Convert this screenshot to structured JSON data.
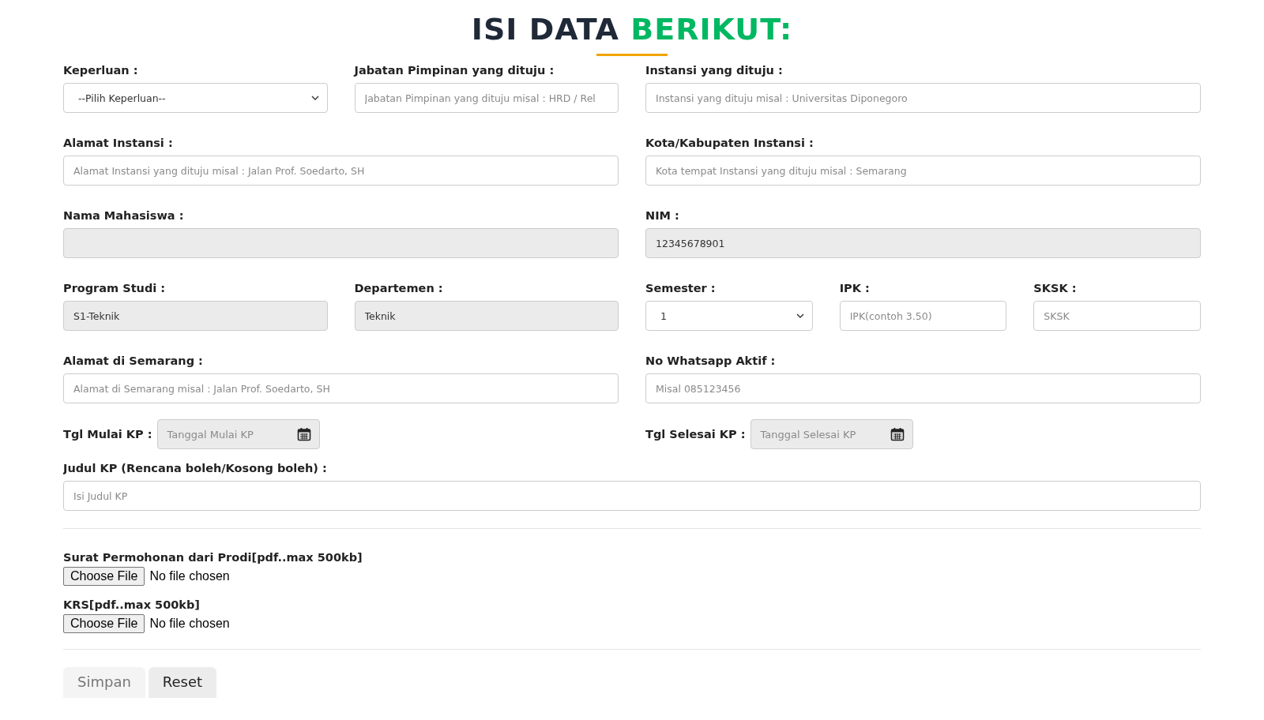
{
  "title": {
    "text": "ISI DATA",
    "highlight": "BERIKUT:"
  },
  "rows": [
    [
      {
        "label": "Keperluan :",
        "kind": "select",
        "value": "--Pilih Keperluan--",
        "readonly": false
      },
      {
        "label": "Jabatan Pimpinan yang dituju :",
        "kind": "text",
        "placeholder": "Jabatan Pimpinan yang dituju misal : HRD / Rel",
        "readonly": false
      },
      {
        "label": "Instansi yang dituju :",
        "kind": "text",
        "placeholder": "Instansi yang dituju misal : Universitas Diponegoro",
        "readonly": false
      }
    ],
    [
      {
        "label": "Alamat Instansi :",
        "kind": "text",
        "placeholder": "Alamat Instansi yang dituju misal : Jalan Prof. Soedarto, SH",
        "readonly": false
      },
      {
        "label": "Kota/Kabupaten Instansi :",
        "kind": "text",
        "placeholder": "Kota tempat Instansi yang dituju misal : Semarang",
        "readonly": false
      }
    ],
    [
      {
        "label": "Nama Mahasiswa :",
        "kind": "text",
        "readonly": true
      },
      {
        "label": "NIM :",
        "kind": "text",
        "value": "12345678901",
        "readonly": true
      }
    ],
    [
      {
        "label": "Program Studi :",
        "kind": "text",
        "value": "S1-Teknik",
        "readonly": true
      },
      {
        "label": "Departemen :",
        "kind": "text",
        "value": "Teknik",
        "readonly": true
      },
      {
        "label": "Semester :",
        "kind": "select",
        "value": "1",
        "readonly": false
      },
      {
        "label": "IPK :",
        "kind": "text",
        "placeholder": "IPK(contoh 3.50)",
        "readonly": false
      },
      {
        "label": "SKSK :",
        "kind": "text",
        "placeholder": "SKSK",
        "readonly": false
      }
    ],
    [
      {
        "label": "Alamat di Semarang :",
        "kind": "text",
        "placeholder": "Alamat di Semarang misal : Jalan Prof. Soedarto, SH",
        "readonly": false
      },
      {
        "label": "No Whatsapp Aktif :",
        "kind": "text",
        "placeholder": "Misal 085123456",
        "readonly": false
      }
    ]
  ],
  "dates": [
    {
      "label": "Tgl Mulai KP :",
      "placeholder": "Tanggal Mulai KP",
      "readonly": true
    },
    {
      "label": "Tgl Selesai KP :",
      "placeholder": "Tanggal Selesai KP",
      "readonly": true
    }
  ],
  "judul": {
    "label": "Judul KP (Rencana boleh/Kosong boleh) :",
    "placeholder": "Isi Judul KP"
  },
  "files": [
    {
      "label": "Surat Permohonan dari Prodi[pdf..max 500kb]",
      "button": "Choose File",
      "status": "No file chosen"
    },
    {
      "label": "KRS[pdf..max 500kb]",
      "button": "Choose File",
      "status": "No file chosen"
    }
  ],
  "buttons": [
    {
      "label": "Simpan",
      "disabled": true
    },
    {
      "label": "Reset",
      "disabled": false
    }
  ]
}
